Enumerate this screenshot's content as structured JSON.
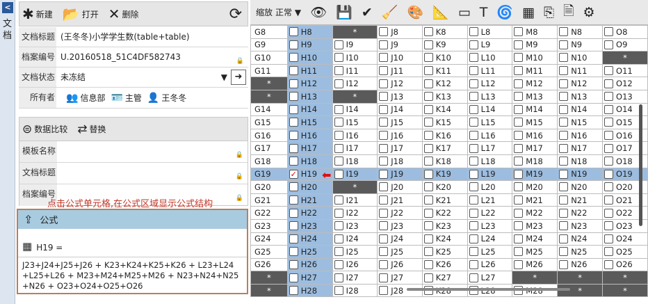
{
  "side_tab": {
    "label": "文档"
  },
  "toolbar": {
    "new_label": "新建",
    "open_label": "打开",
    "delete_label": "删除"
  },
  "doc_fields": [
    {
      "label": "文档标题",
      "value": "(王冬冬)小学学生数(table+table)"
    },
    {
      "label": "档案编号",
      "value": "U.20160518_51C4DF582743"
    },
    {
      "label": "文档状态",
      "value": "未冻结"
    },
    {
      "label": "所有者",
      "value": ""
    }
  ],
  "owners": [
    "信息部",
    "主管",
    "王冬冬"
  ],
  "compare": {
    "compare_label": "数据比较",
    "replace_label": "替换"
  },
  "template_fields": [
    {
      "label": "模板名称",
      "value": ""
    },
    {
      "label": "文档标题",
      "value": ""
    },
    {
      "label": "档案编号",
      "value": ""
    }
  ],
  "annotation": "点击公式单元格,在公式区域显示公式结构",
  "formula": {
    "title": "公式",
    "cell_ref": "H19 =",
    "expression": "J23+J24+J25+J26 +  K23+K24+K25+K26 + L23+L24 +L25+L26 + M23+M24+M25+M26 + N23+N24+N25 +N26 + O23+O24+O25+O26"
  },
  "right_toolbar": {
    "zoom_label": "缩放",
    "zoom_value": "正常"
  },
  "grid": {
    "columns": [
      "G",
      "H",
      "I",
      "J",
      "K",
      "L",
      "M",
      "N",
      "O"
    ],
    "highlight_row": 19,
    "rows": [
      {
        "n": 8,
        "dark": [
          "I"
        ]
      },
      {
        "n": 9,
        "dark": []
      },
      {
        "n": 10,
        "dark": [
          "O"
        ]
      },
      {
        "n": 11,
        "dark": []
      },
      {
        "n": 12,
        "dark": [
          "G"
        ]
      },
      {
        "n": 13,
        "dark": [
          "G",
          "I"
        ]
      },
      {
        "n": 14,
        "dark": []
      },
      {
        "n": 15,
        "dark": []
      },
      {
        "n": 16,
        "dark": []
      },
      {
        "n": 17,
        "dark": []
      },
      {
        "n": 18,
        "dark": []
      },
      {
        "n": 19,
        "dark": []
      },
      {
        "n": 20,
        "dark": [
          "I"
        ]
      },
      {
        "n": 21,
        "dark": []
      },
      {
        "n": 22,
        "dark": []
      },
      {
        "n": 23,
        "dark": []
      },
      {
        "n": 24,
        "dark": []
      },
      {
        "n": 25,
        "dark": []
      },
      {
        "n": 26,
        "dark": []
      },
      {
        "n": 27,
        "dark": [
          "G",
          "M",
          "N",
          "O"
        ]
      },
      {
        "n": 28,
        "dark": [
          "G",
          "N",
          "O"
        ]
      }
    ],
    "dark_mark": "*"
  }
}
